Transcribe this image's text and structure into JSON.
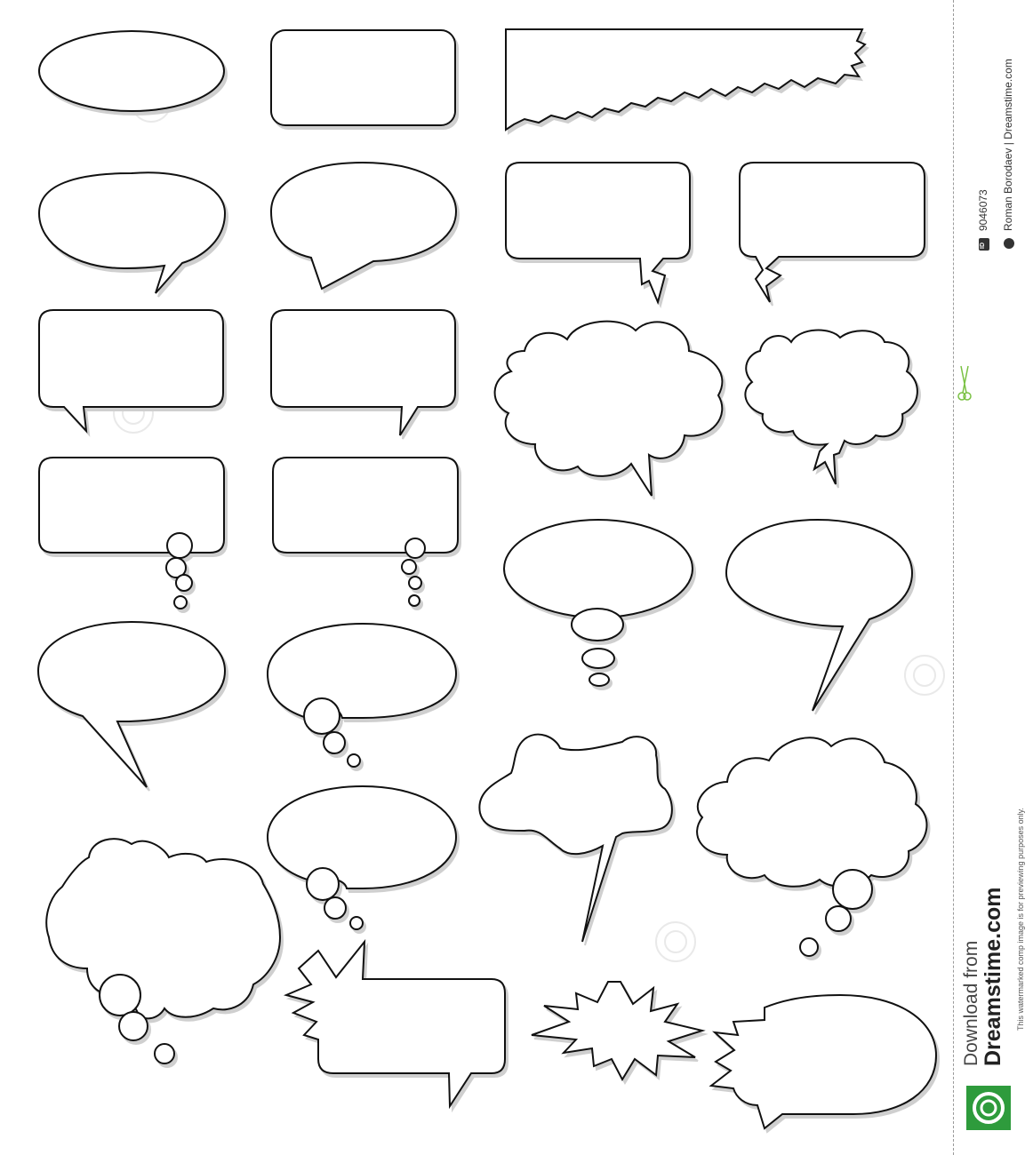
{
  "colors": {
    "outline": "#111111",
    "shadow": "#cfcfcf",
    "divider": "#9a9a9a",
    "logo_green": "#2e9b3c",
    "scissors_green": "#7ac143"
  },
  "watermark": {
    "text": "dreamstime"
  },
  "sidebar": {
    "id_badge": "ID",
    "id_number": "9046073",
    "copyright_icon": "copyright-icon",
    "credit": "Roman Borodaev | Dreamstime.com",
    "notice": "This watermarked comp image is for previewing purposes only.",
    "download_label": "Download from",
    "site_name": "Dreamstime.com",
    "logo_icon": "dreamstime-spiral-logo-icon",
    "scissors_icon": "scissors-icon"
  }
}
